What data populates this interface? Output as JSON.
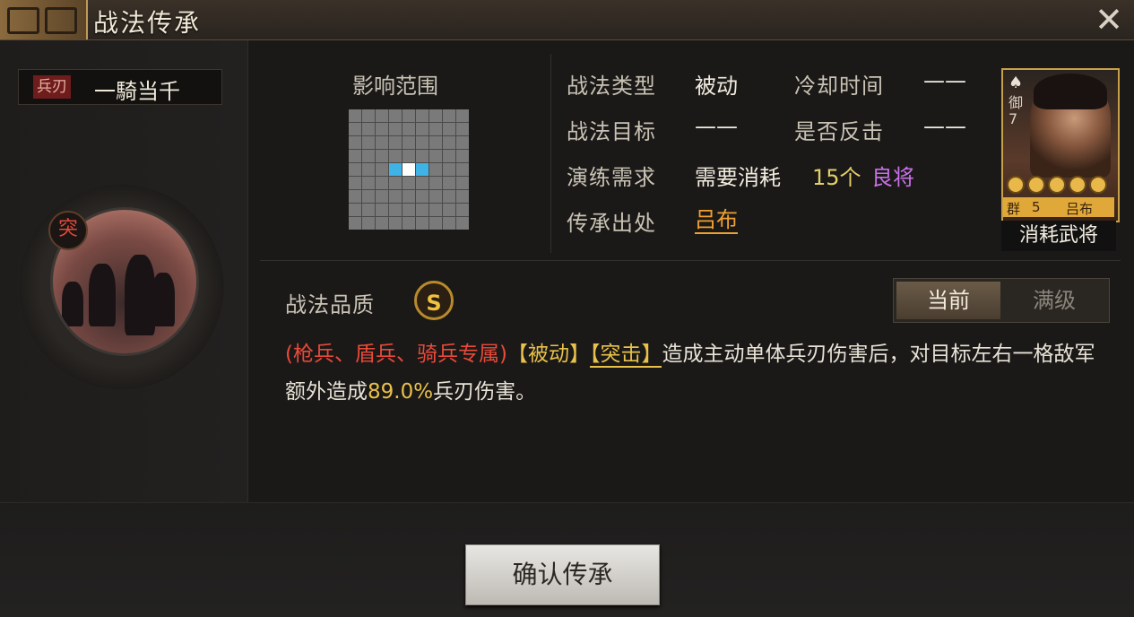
{
  "window": {
    "title": "战法传承",
    "close_icon": "close-icon"
  },
  "skill": {
    "type_tag": "兵刃",
    "name": "一騎当千",
    "badge": "突"
  },
  "range": {
    "label": "影响范围"
  },
  "info": {
    "type_label": "战法类型",
    "type_value": "被动",
    "cooldown_label": "冷却时间",
    "cooldown_value": "——",
    "target_label": "战法目标",
    "target_value": "——",
    "counter_label": "是否反击",
    "counter_value": "——",
    "drill_label": "演练需求",
    "drill_prefix": "需要消耗",
    "drill_count": "15个",
    "drill_item": "良将",
    "source_label": "传承出处",
    "source_value": "吕布"
  },
  "general_card": {
    "shield_text": "御7",
    "faction": "群",
    "cost": "5",
    "name": "吕布",
    "stars": 5,
    "consume_label": "消耗武将"
  },
  "quality": {
    "label": "战法品质",
    "grade": "S"
  },
  "tabs": {
    "current": "当前",
    "max": "满级"
  },
  "description": {
    "restrict": "(枪兵、盾兵、骑兵专属)",
    "tag_passive": "【被动】",
    "tag_assault": "【突击】",
    "text1": "造成主动单体兵刃伤害后，对目标左右一格敌军额外造成",
    "value": "89.0%",
    "text2": "兵刃伤害。"
  },
  "footer": {
    "confirm_label": "确认传承"
  },
  "colors": {
    "accent_gold": "#c7a14a",
    "range_hit": "#3fb2e6",
    "restrict_red": "#e84a3a"
  }
}
